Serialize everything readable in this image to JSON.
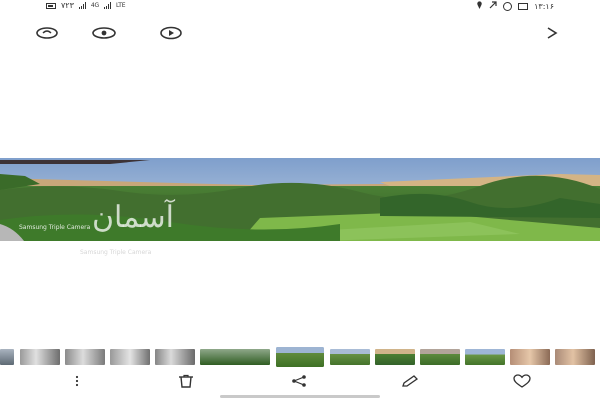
{
  "status_bar": {
    "time": "۱۳:۱۶",
    "data_speed": "۷۲۳",
    "network_left": "4G",
    "network_right": "LTE",
    "icons": [
      "battery-icon",
      "signal-icon",
      "signal-icon",
      "location-icon",
      "whatsapp-icon",
      "image-icon"
    ]
  },
  "toolbar": {
    "icons": [
      "adjust-icon",
      "view-icon",
      "play-icon",
      "forward-icon"
    ]
  },
  "photo": {
    "watermark": "آسمان",
    "camera_label": "Samsung Triple Camera",
    "caption": "Samsung Triple Camera"
  },
  "filmstrip": {
    "count": 13,
    "selected_index": 6
  },
  "bottom_bar": {
    "icons": [
      "more-icon",
      "delete-icon",
      "share-icon",
      "edit-icon",
      "favorite-icon"
    ]
  },
  "colors": {
    "sky": "#8ea9cf",
    "hills": "#c8a77a",
    "foliage": "#3f7d2d",
    "grass": "#7fb84a",
    "icon": "#333333"
  }
}
